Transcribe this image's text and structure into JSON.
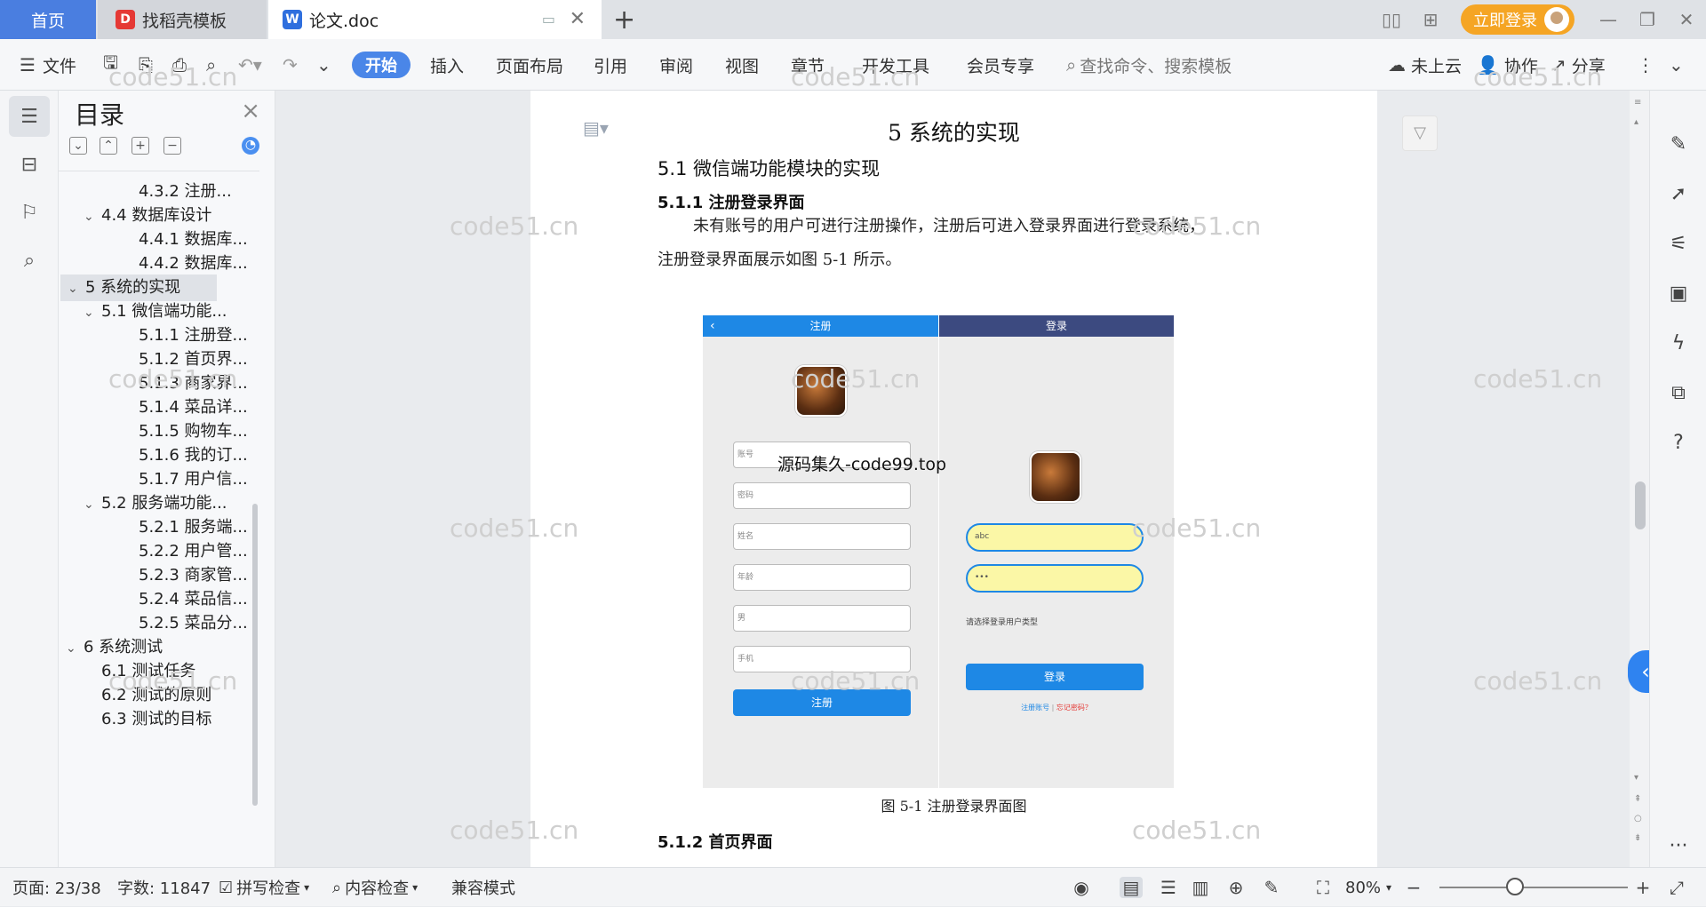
{
  "tabs": {
    "home": "首页",
    "template": "找稻壳模板",
    "doc": "论文.doc"
  },
  "titlebar": {
    "login": "立即登录"
  },
  "ribbon": {
    "file": "文件",
    "tabs": [
      "开始",
      "插入",
      "页面布局",
      "引用",
      "审阅",
      "视图",
      "章节",
      "开发工具",
      "会员专享"
    ],
    "search_placeholder": "查找命令、搜索模板",
    "cloud": "未上云",
    "collab": "协作",
    "share": "分享"
  },
  "toc": {
    "title": "目录",
    "items": [
      {
        "label": "4.3.2 注册...",
        "level": 3
      },
      {
        "label": "4.4 数据库设计",
        "level": 2,
        "caret": "﹀"
      },
      {
        "label": "4.4.1 数据库...",
        "level": 3
      },
      {
        "label": "4.4.2 数据库...",
        "level": 3
      },
      {
        "label": "5 系统的实现",
        "level": 1,
        "caret": "﹀",
        "selected": true
      },
      {
        "label": "5.1 微信端功能...",
        "level": 2,
        "caret": "﹀"
      },
      {
        "label": "5.1.1 注册登...",
        "level": 3
      },
      {
        "label": "5.1.2 首页界...",
        "level": 3
      },
      {
        "label": "5.1.3 商家界...",
        "level": 3
      },
      {
        "label": "5.1.4 菜品详...",
        "level": 3
      },
      {
        "label": "5.1.5 购物车...",
        "level": 3
      },
      {
        "label": "5.1.6 我的订...",
        "level": 3
      },
      {
        "label": "5.1.7 用户信...",
        "level": 3
      },
      {
        "label": "5.2 服务端功能...",
        "level": 2,
        "caret": "﹀"
      },
      {
        "label": "5.2.1 服务端...",
        "level": 3
      },
      {
        "label": "5.2.2 用户管...",
        "level": 3
      },
      {
        "label": "5.2.3 商家管...",
        "level": 3
      },
      {
        "label": "5.2.4 菜品信...",
        "level": 3
      },
      {
        "label": "5.2.5 菜品分...",
        "level": 3
      },
      {
        "label": "6 系统测试",
        "level": 1,
        "caret": "﹀"
      },
      {
        "label": "6.1 测试任务",
        "level": 2
      },
      {
        "label": "6.2 测试的原则",
        "level": 2
      },
      {
        "label": "6.3 测试的目标",
        "level": 2
      }
    ]
  },
  "document": {
    "heading": "5  系统的实现",
    "h2": "5.1 微信端功能模块的实现",
    "h3_1": "5.1.1 注册登录界面",
    "para1": "未有账号的用户可进行注册操作，注册后可进入登录界面进行登录系统，",
    "para2": "注册登录界面展示如图 5-1 所示。",
    "caption": "图 5-1  注册登录界面图",
    "h3_2": "5.1.2 首页界面",
    "watermark": "code51.cn",
    "overlay": "源码集久-code99.top"
  },
  "figure": {
    "register_title": "注册",
    "register_fields": [
      "账号",
      "密码",
      "姓名",
      "年龄",
      "男",
      "手机"
    ],
    "register_button": "注册",
    "login_title": "登录",
    "login_field1": "abc",
    "login_field2": "•••",
    "user_type": "请选择登录用户类型",
    "login_button": "登录",
    "register_link": "注册账号",
    "forgot_link": "忘记密码？"
  },
  "status": {
    "page": "页面: 23/38",
    "words": "字数: 11847",
    "spell": "拼写检查",
    "content": "内容检查",
    "compat": "兼容模式",
    "zoom": "80%",
    "zoom_fraction": 0.8
  }
}
